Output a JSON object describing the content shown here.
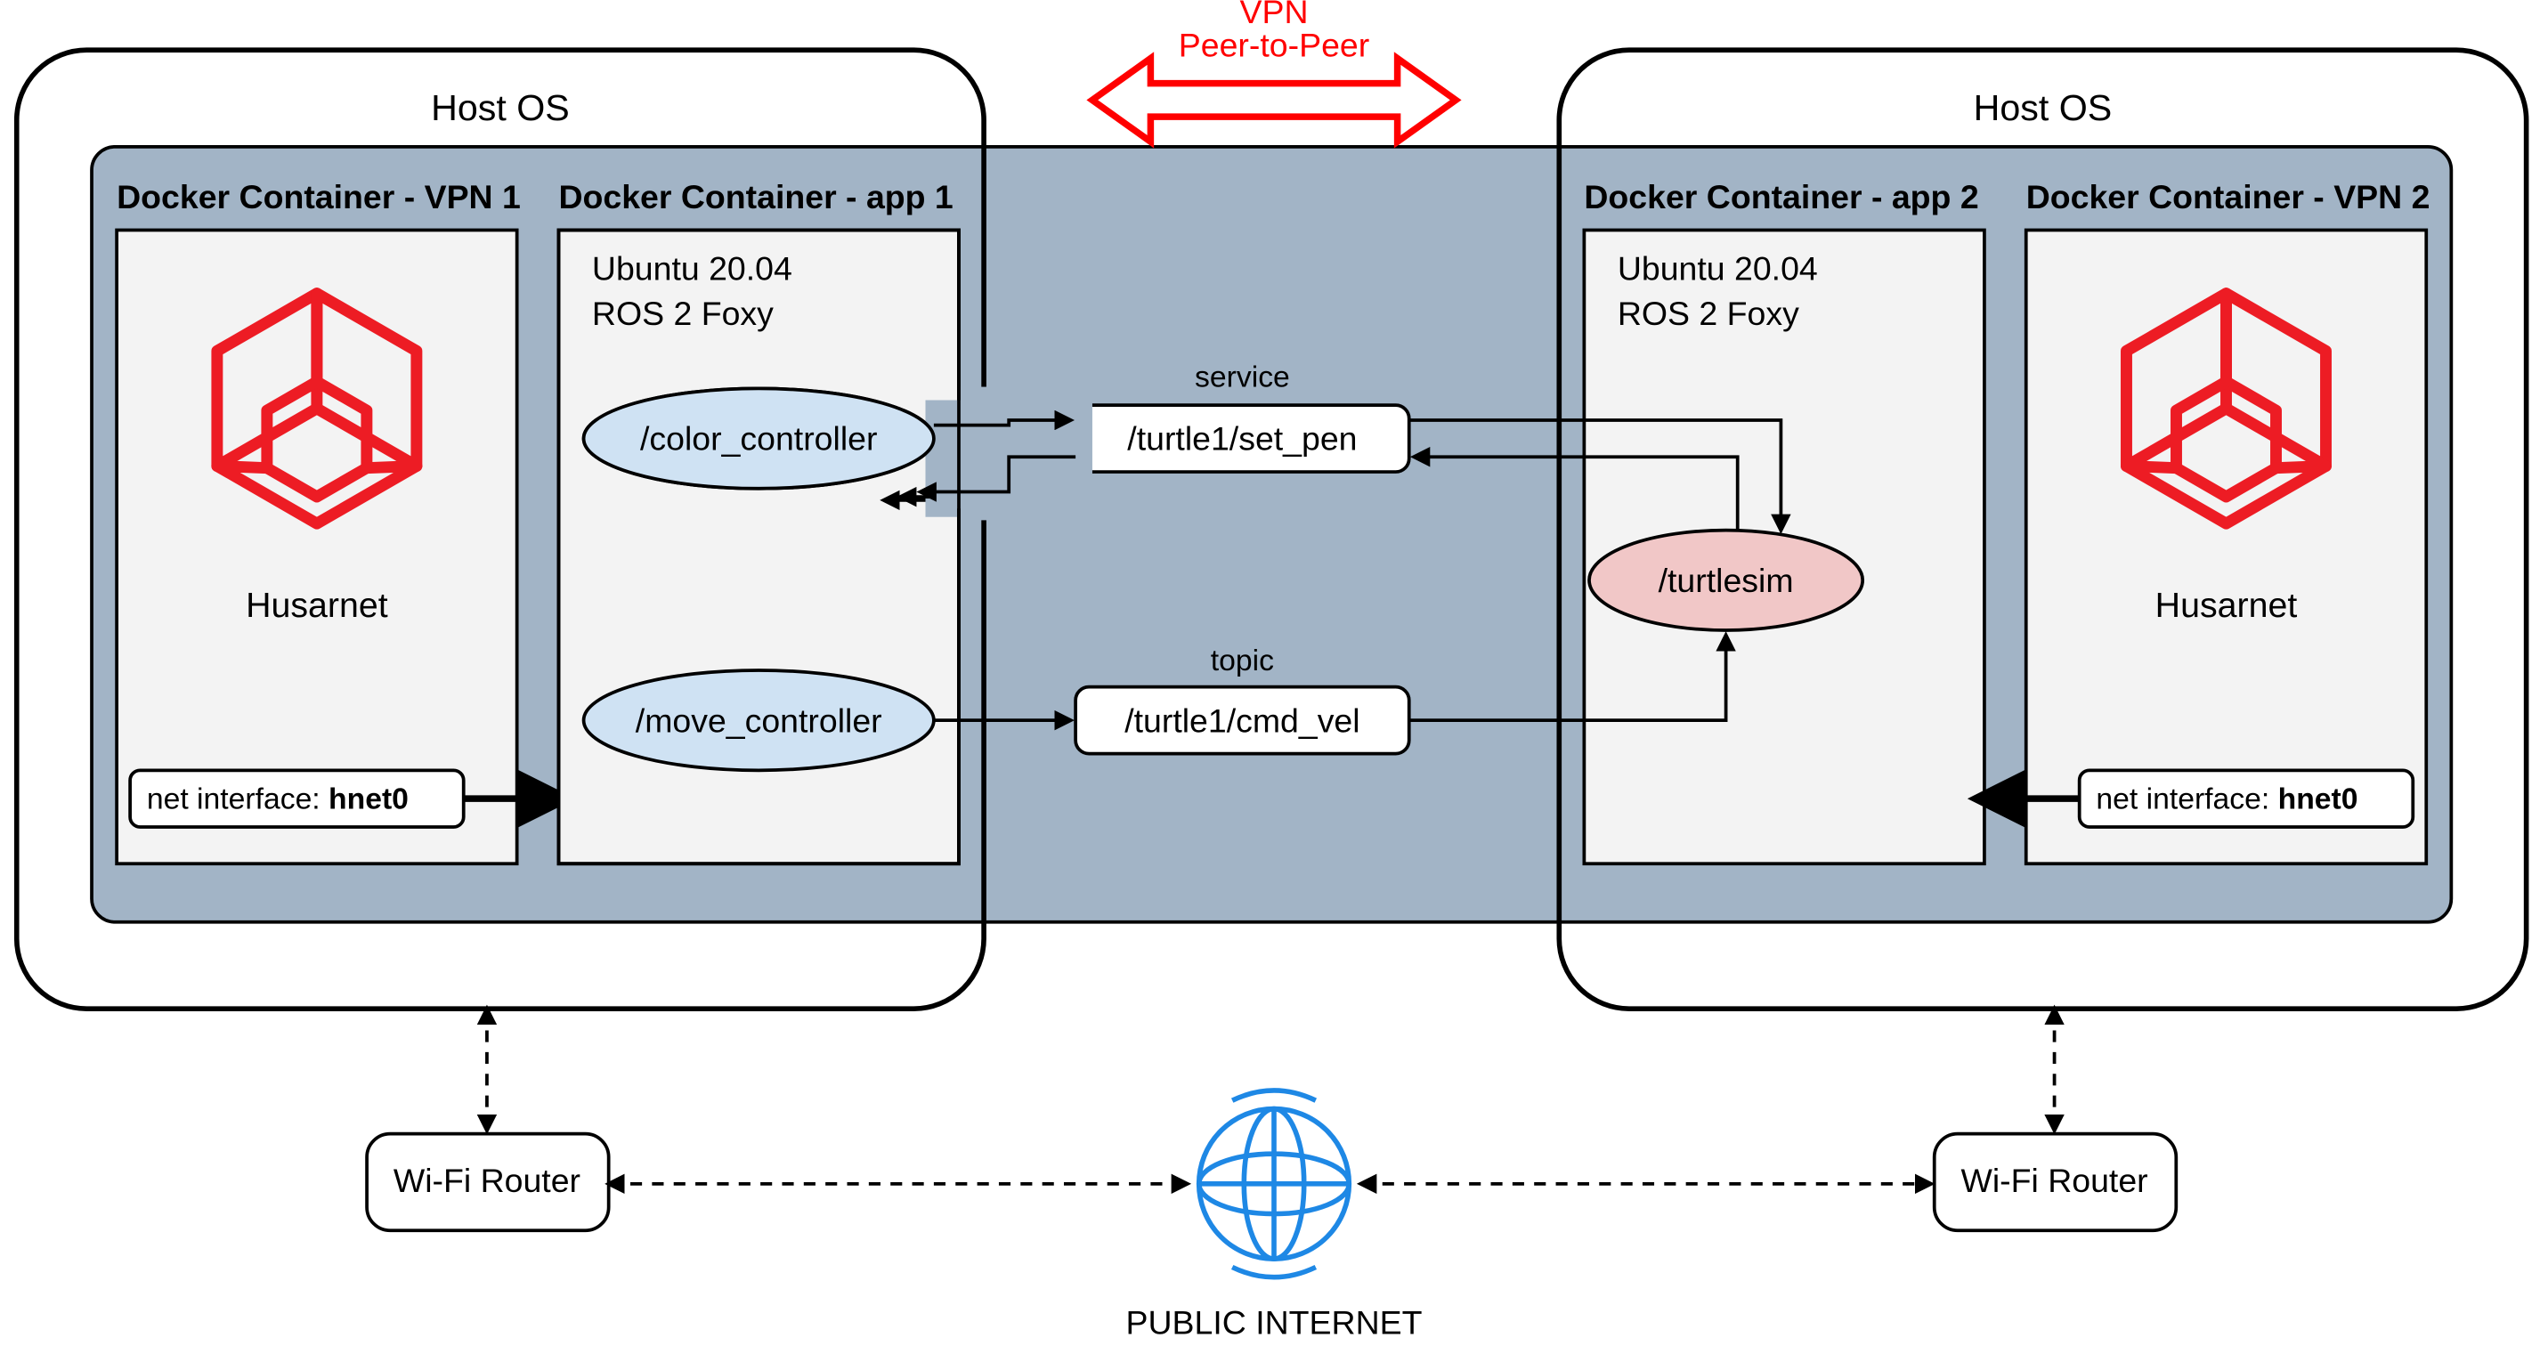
{
  "vpn_label_1": "VPN",
  "vpn_label_2": "Peer-to-Peer",
  "host_os_left": "Host OS",
  "host_os_right": "Host OS",
  "container_vpn1_title": "Docker Container - VPN 1",
  "container_app1_title": "Docker Container - app 1",
  "container_app2_title": "Docker Container - app 2",
  "container_vpn2_title": "Docker Container - VPN 2",
  "app1_line1": "Ubuntu 20.04",
  "app1_line2": "ROS 2 Foxy",
  "app2_line1": "Ubuntu 20.04",
  "app2_line2": "ROS 2 Foxy",
  "husarnet_left": "Husarnet",
  "husarnet_right": "Husarnet",
  "net_if_prefix_left": "net interface: ",
  "net_if_bold_left": "hnet0",
  "net_if_prefix_right": "net interface: ",
  "net_if_bold_right": "hnet0",
  "node_color_controller": "/color_controller",
  "node_move_controller": "/move_controller",
  "node_turtlesim": "/turtlesim",
  "service_label": "service",
  "service_box": "/turtle1/set_pen",
  "topic_label": "topic",
  "topic_box": "/turtle1/cmd_vel",
  "wifi_left": "Wi-Fi Router",
  "wifi_right": "Wi-Fi Router",
  "public_internet": "PUBLIC INTERNET"
}
